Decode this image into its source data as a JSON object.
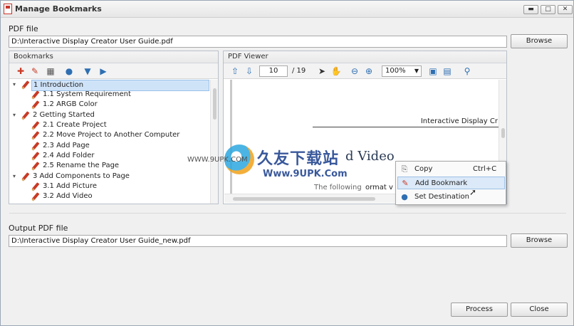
{
  "window": {
    "title": "Manage Bookmarks",
    "controls": {
      "minimize": "▬",
      "maximize": "□",
      "close": "✕"
    }
  },
  "input_pdf": {
    "label": "PDF file",
    "value": "D:\\Interactive Display Creator User Guide.pdf",
    "browse_label": "Browse"
  },
  "bookmarks_panel": {
    "title": "Bookmarks",
    "toolbar": [
      {
        "name": "add-bookmark-icon",
        "glyph": "+"
      },
      {
        "name": "edit-bookmark-icon",
        "glyph": "-"
      },
      {
        "name": "delete-icon",
        "glyph": "🗑"
      },
      {
        "name": "set-destination-icon",
        "glyph": "●"
      },
      {
        "name": "move-down-icon",
        "glyph": "▼"
      },
      {
        "name": "move-right-icon",
        "glyph": "▶"
      }
    ],
    "items": [
      {
        "label": "1 Introduction",
        "level": 0,
        "expander": "▾",
        "selected": true
      },
      {
        "label": "1.1 System Requirement",
        "level": 1
      },
      {
        "label": "1.2 ARGB Color",
        "level": 1
      },
      {
        "label": "2 Getting Started",
        "level": 0,
        "expander": "▾"
      },
      {
        "label": "2.1 Create Project",
        "level": 1
      },
      {
        "label": "2.2 Move Project to Another Computer",
        "level": 1
      },
      {
        "label": "2.3 Add Page",
        "level": 1
      },
      {
        "label": "2.4 Add Folder",
        "level": 1
      },
      {
        "label": "2.5 Rename the Page",
        "level": 1
      },
      {
        "label": "3 Add Components to Page",
        "level": 0,
        "expander": "▾"
      },
      {
        "label": "3.1 Add Picture",
        "level": 1
      },
      {
        "label": "3.2 Add Video",
        "level": 1
      }
    ]
  },
  "viewer_panel": {
    "title": "PDF Viewer",
    "current_page": "10",
    "page_total": "/ 19",
    "zoom": "100%",
    "doc_header": "Interactive Display Cr",
    "doc_heading": "d Video",
    "doc_body_faint": "The following",
    "doc_body": "ormat v"
  },
  "context_menu": {
    "items": [
      {
        "label": "Copy",
        "shortcut": "Ctrl+C",
        "icon": "copy-icon",
        "glyph": "⎘",
        "color": "#6b6b6b"
      },
      {
        "label": "Add Bookmark",
        "shortcut": "",
        "icon": "add-bookmark-icon",
        "glyph": "✎",
        "color": "#c93a25",
        "highlighted": true
      },
      {
        "label": "Set Destination",
        "shortcut": "",
        "icon": "location-pin-icon",
        "glyph": "●",
        "color": "#2f6fb2"
      }
    ]
  },
  "output_pdf": {
    "label": "Output PDF file",
    "value": "D:\\Interactive Display Creator User Guide_new.pdf",
    "browse_label": "Browse"
  },
  "actions": {
    "process": "Process",
    "close": "Close"
  },
  "watermark": {
    "title": "久友下载站",
    "url_left": "WWW.9UPK.COM",
    "url": "Www.9UPK.Com"
  }
}
